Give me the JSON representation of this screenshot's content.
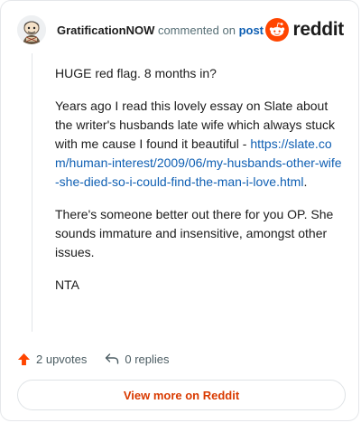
{
  "header": {
    "username": "GratificationNOW",
    "action_text": " commented on ",
    "post_link_label": "post",
    "brand": "reddit"
  },
  "comment": {
    "para1": "HUGE red flag. 8 months in?",
    "para2_text": "Years ago I read this lovely essay on Slate about the writer's husbands late wife which always stuck with me cause I found it beautiful - ",
    "para2_link": "https://slate.com/human-interest/2009/06/my-husbands-other-wife-she-died-so-i-could-find-the-man-i-love.html",
    "para2_end": ".",
    "para3": "There's someone better out there for you OP. She sounds immature and insensitive, amongst other issues.",
    "para4": "NTA"
  },
  "stats": {
    "upvotes": "2 upvotes",
    "replies": "0 replies"
  },
  "footer": {
    "view_more_label": "View more on Reddit"
  },
  "colors": {
    "brand_orange": "#ff4500",
    "link_blue": "#0f5fb3",
    "button_text": "#d93a00"
  }
}
